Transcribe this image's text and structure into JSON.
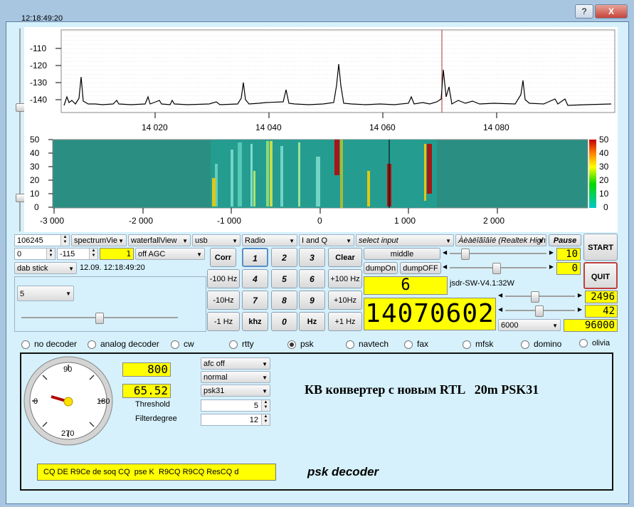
{
  "titlebar": {
    "help_label": "?",
    "close_label": "X"
  },
  "clock": "12:18:49:20",
  "spectrum": {
    "y_ticks": [
      "-110",
      "-120",
      "-130",
      "-140"
    ],
    "x_ticks": [
      "14 020",
      "14 040",
      "14 060",
      "14 080"
    ]
  },
  "waterfall": {
    "y_ticks": [
      "50",
      "40",
      "30",
      "20",
      "10",
      "0"
    ],
    "x_ticks": [
      "-3 000",
      "-2 000",
      "-1 000",
      "0",
      "1 000",
      "2 000"
    ],
    "scale_ticks": [
      "50",
      "40",
      "30",
      "20",
      "10",
      "0"
    ]
  },
  "controls": {
    "freq_spin": "106245",
    "view1": "spectrumVie",
    "view2": "waterfallView",
    "mode": "usb",
    "radio": "Radio",
    "iq": "I and Q",
    "input": "select input",
    "device": "Àèàëîãîâîé (Realtek High",
    "pause_label": "Pause",
    "start_label": "START",
    "quit_label": "QUIT",
    "gain_spin": "0",
    "gain2_spin": "-115",
    "yellow_small": "1",
    "agc": "off AGC",
    "dab": "dab stick",
    "datetime": "12.09. 12:18:49:20",
    "left_combo": "5",
    "middle_label": "middle",
    "dump_on": "dumpOn",
    "dump_off": "dumpOFF",
    "lcd_10": "10",
    "lcd_0": "0",
    "lcd_6": "6",
    "version": "jsdr-SW-V4.1:32W",
    "lcd_2496": "2496",
    "lcd_42": "42",
    "lcd_main": "14070602",
    "bw_select": "6000",
    "lcd_96000": "96000"
  },
  "keypad": {
    "corr": "Corr",
    "clear": "Clear",
    "khz": "khz",
    "hz": "Hz",
    "m100": "-100 Hz",
    "p100": "+100 Hz",
    "m10": "-10Hz",
    "p10": "+10Hz",
    "m1": "-1 Hz",
    "p1": "+1 Hz",
    "d1": "1",
    "d2": "2",
    "d3": "3",
    "d4": "4",
    "d5": "5",
    "d6": "6",
    "d7": "7",
    "d8": "8",
    "d9": "9",
    "d0": "0"
  },
  "decoders": [
    {
      "label": "no decoder"
    },
    {
      "label": "analog decoder"
    },
    {
      "label": "cw"
    },
    {
      "label": "rtty"
    },
    {
      "label": "psk"
    },
    {
      "label": "navtech"
    },
    {
      "label": "fax"
    },
    {
      "label": "mfsk"
    },
    {
      "label": "domino"
    },
    {
      "label": "olivia"
    }
  ],
  "psk": {
    "dial_ticks": {
      "top": "90",
      "left": "0",
      "right": "180",
      "bottom": "270"
    },
    "lcd_800": "800",
    "lcd_6552": "65.52",
    "threshold_label": "Threshold",
    "filter_label": "Filterdegree",
    "afc": "afc off",
    "normal": "normal",
    "psk31": "psk31",
    "threshold_val": "5",
    "filter_val": "12",
    "title": "КВ конвертер с новым RTL   20m PSK31",
    "decoded_text": "CQ DE R9Ce de soq CQ  pse K  R9CQ R9CQ ResCQ d",
    "footer": "psk decoder"
  }
}
